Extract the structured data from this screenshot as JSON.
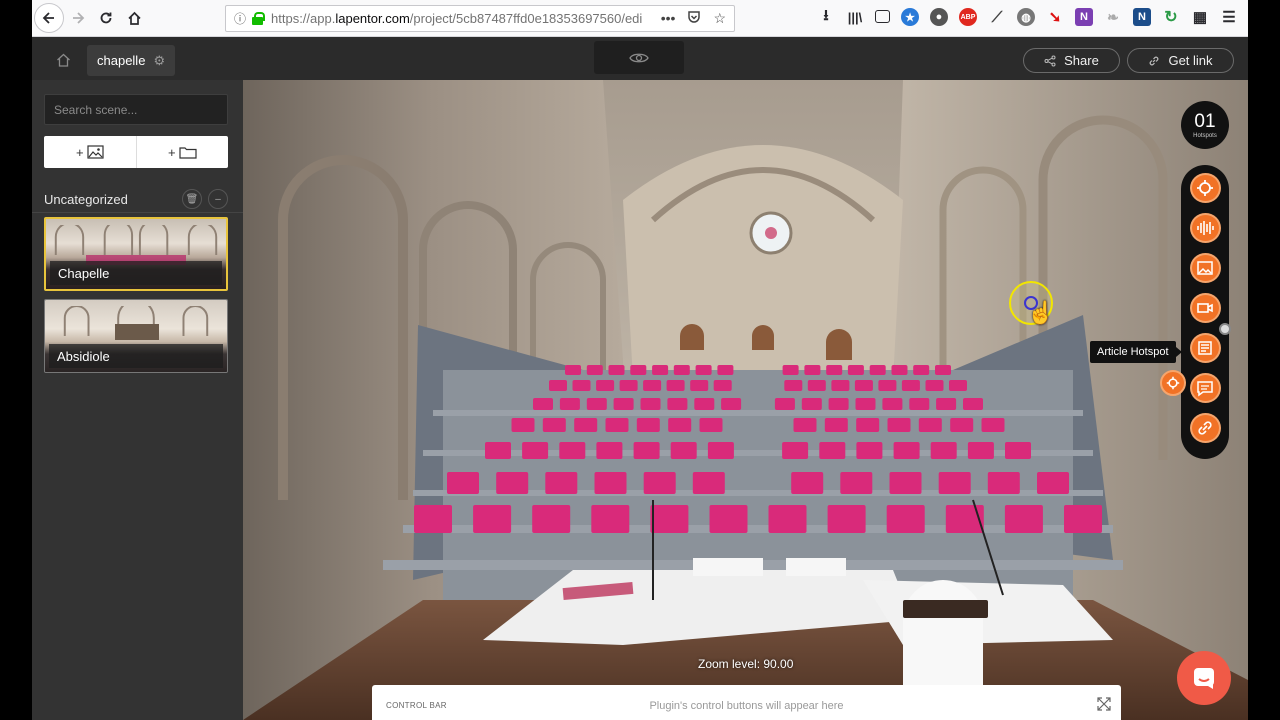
{
  "browser": {
    "url_prefix": "https://app.",
    "url_domain": "lapentor.com",
    "url_rest": "/project/5cb87487ffd0e18353697560/edi",
    "toolbar_icons": [
      "download-icon",
      "library-icon",
      "reader-icon",
      "extension-blue",
      "extension-gray",
      "adblock-icon",
      "dropper-icon",
      "globe-icon",
      "arrow-icon",
      "onenote-icon",
      "leaf-icon",
      "n-icon",
      "refresh-icon",
      "qr-icon",
      "menu-icon"
    ]
  },
  "header": {
    "project_name": "chapelle",
    "share_label": "Share",
    "getlink_label": "Get link"
  },
  "sidebar": {
    "search_placeholder": "Search scene...",
    "add_image_label": "+",
    "add_folder_label": "+",
    "group_name": "Uncategorized",
    "scenes": [
      {
        "label": "Chapelle",
        "active": true
      },
      {
        "label": "Absidiole",
        "active": false
      }
    ]
  },
  "viewer": {
    "hotspot_count": "01",
    "hotspot_count_label": "Hotspots",
    "tooltip": "Article Hotspot",
    "zoom_text": "Zoom level: 90.00",
    "control_bar_title": "CONTROL BAR",
    "control_bar_msg": "Plugin's control buttons will appear here",
    "hotspot_types": [
      "point-hotspot-icon",
      "sound-hotspot-icon",
      "image-hotspot-icon",
      "video-hotspot-icon",
      "article-hotspot-icon",
      "textbox-hotspot-icon",
      "url-hotspot-icon"
    ]
  },
  "colors": {
    "accent_orange": "#f17226",
    "active_scene_border": "#e8c43c",
    "chat_button": "#f05a47"
  }
}
